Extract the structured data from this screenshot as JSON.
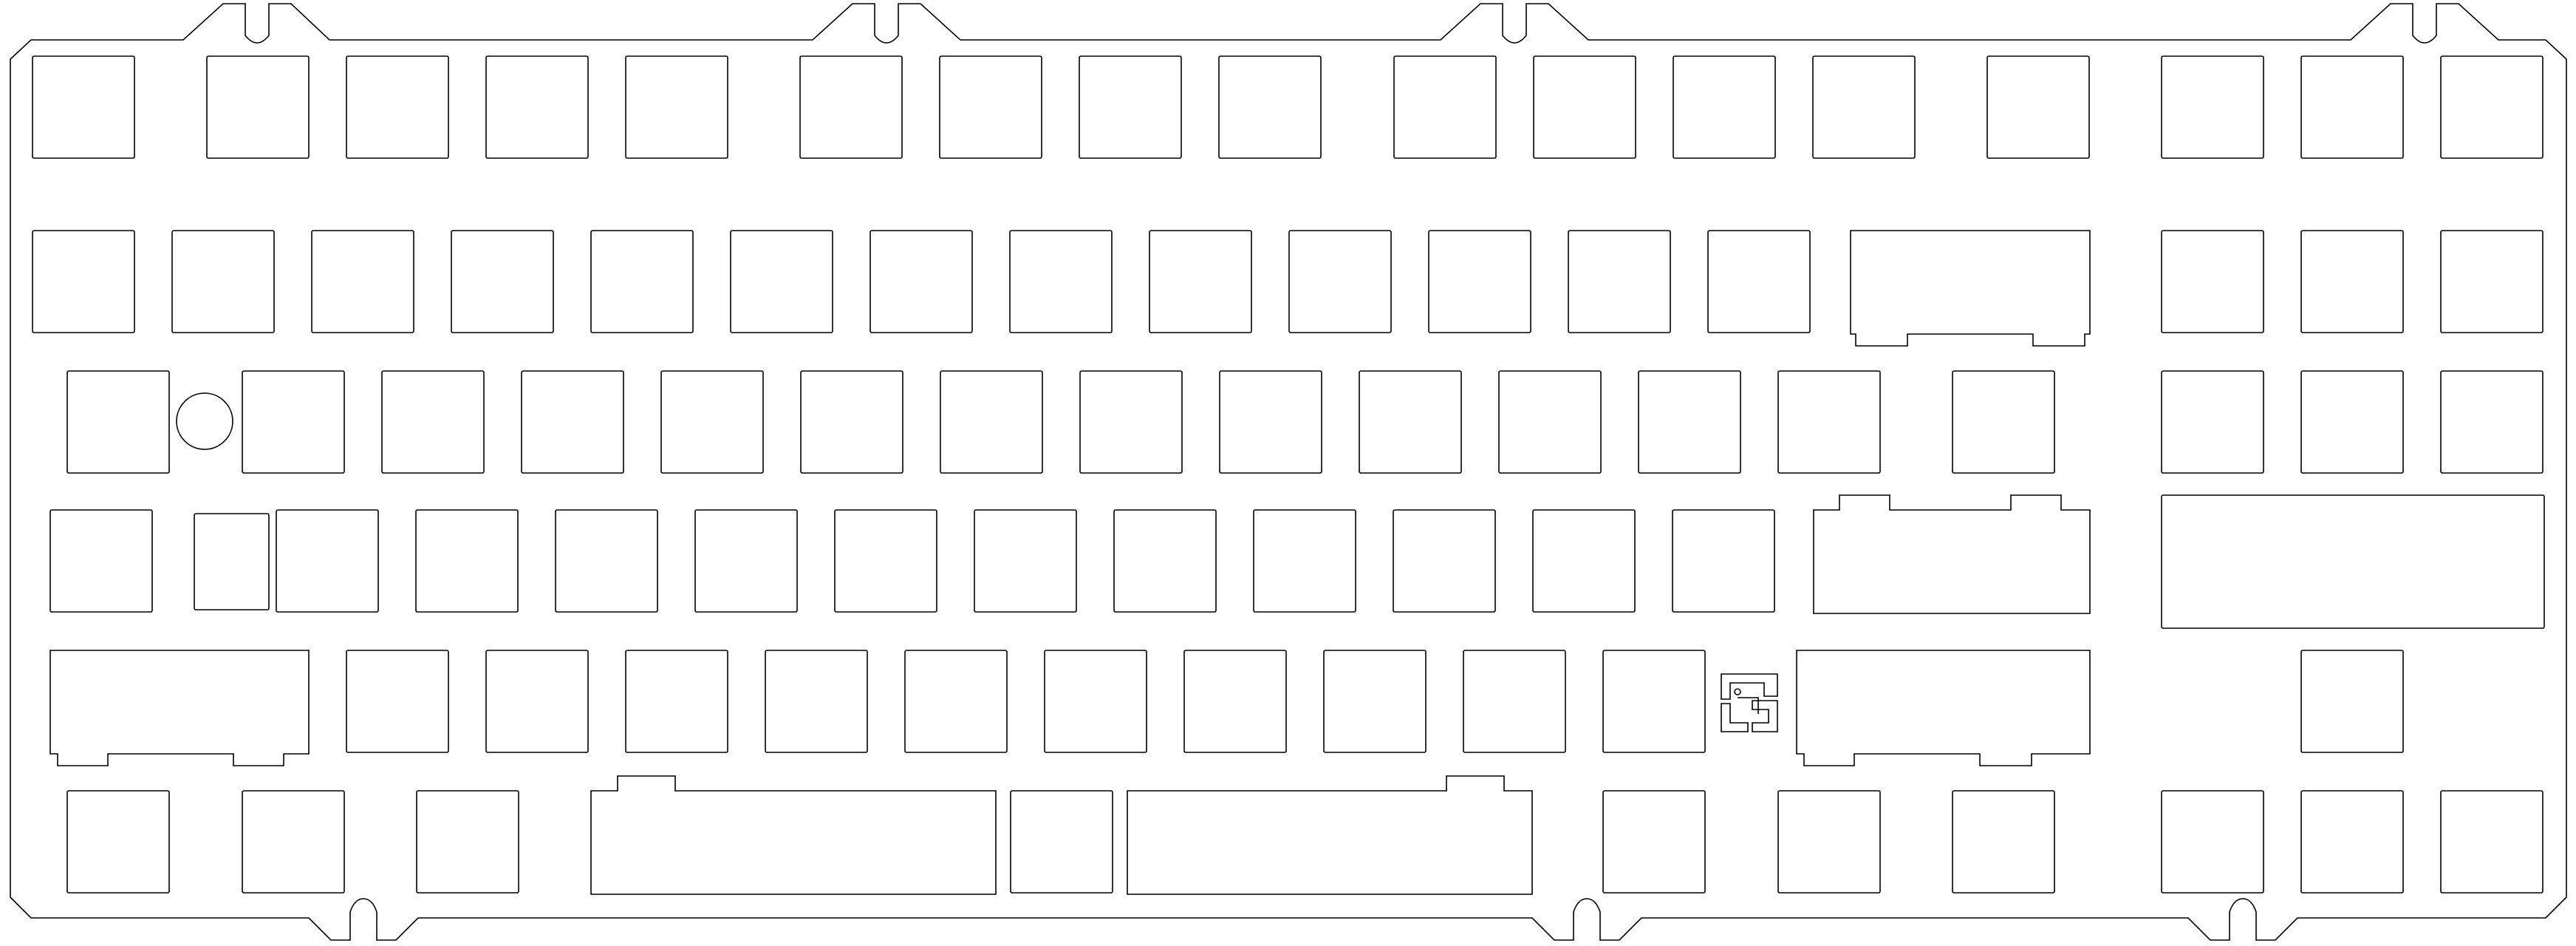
{
  "drawing": {
    "type": "keyboard-plate-outline",
    "background": "#ffffff",
    "line_color": "#000000",
    "text": [],
    "icons": [
      "alignment-hole-icon",
      "stabilizer-cutout-icon",
      "logo-mark-icon"
    ]
  }
}
